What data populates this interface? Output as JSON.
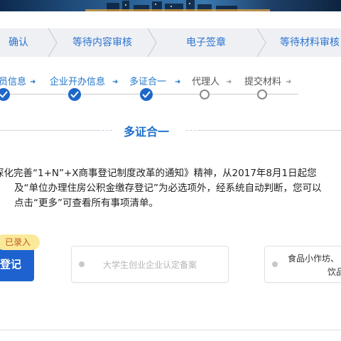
{
  "process_steps": [
    {
      "label": "确认"
    },
    {
      "label": "等待内容审核"
    },
    {
      "label": "电子签章"
    },
    {
      "label": "等待材料审核"
    }
  ],
  "sub_steps": [
    {
      "label": "员信息",
      "status": "done"
    },
    {
      "label": "企业开办信息",
      "status": "done"
    },
    {
      "label": "多证合一",
      "status": "done"
    },
    {
      "label": "代理人",
      "status": "pending"
    },
    {
      "label": "提交材料",
      "status": "pending"
    }
  ],
  "section_title": "多证合一",
  "notice_lines": [
    "深化完善“1+N”+X商事登记制度改革的通知》精神，从2017年8月1日起您",
    "及“单位办理住房公积金缴存登记”为必选项外，经系统自动判断，您可以",
    "点击“更多”可查看所有事项清单。"
  ],
  "cards": {
    "selected_label": "登记",
    "badge": "已录入",
    "option1": "大学生创业企业认定备案",
    "option2_line1": "食品小作坊、",
    "option2_line2": "饮品"
  },
  "colors": {
    "accent": "#1e67c8",
    "badge_bg": "#fbe99a",
    "badge_text": "#c0571a"
  }
}
